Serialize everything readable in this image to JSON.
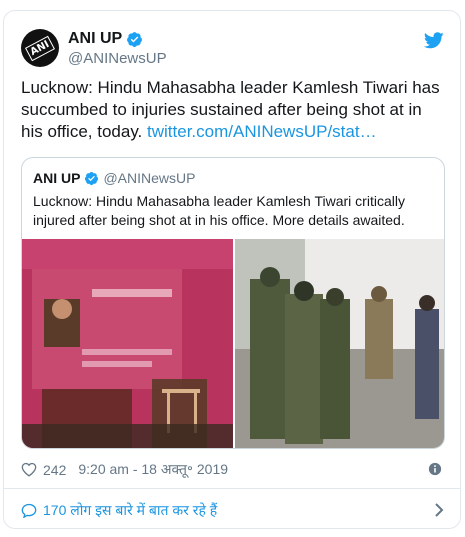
{
  "tweet": {
    "display_name": "ANI UP",
    "handle": "@ANINewsUP",
    "avatar_text": "ANI",
    "text": "Lucknow: Hindu Mahasabha leader Kamlesh Tiwari has succumbed to injuries sustained after being shot at in his office, today.",
    "link": "twitter.com/ANINewsUP/stat…",
    "likes": "242",
    "timestamp": "9:20 am - 18 अक्तू॰ 2019"
  },
  "quoted": {
    "display_name": "ANI UP",
    "handle": "@ANINewsUP",
    "text": "Lucknow: Hindu Mahasabha leader Kamlesh Tiwari critically injured after being shot at in his office. More details awaited."
  },
  "replies_label": "170 लोग इस बारे में बात कर रहे हैं",
  "colors": {
    "link": "#1b95e0",
    "secondary_text": "#657786",
    "verified": "#1da1f2"
  },
  "icons": [
    "twitter-bird-icon",
    "verified-badge-icon",
    "heart-icon",
    "info-icon",
    "reply-bubble-icon",
    "chevron-right-icon"
  ]
}
